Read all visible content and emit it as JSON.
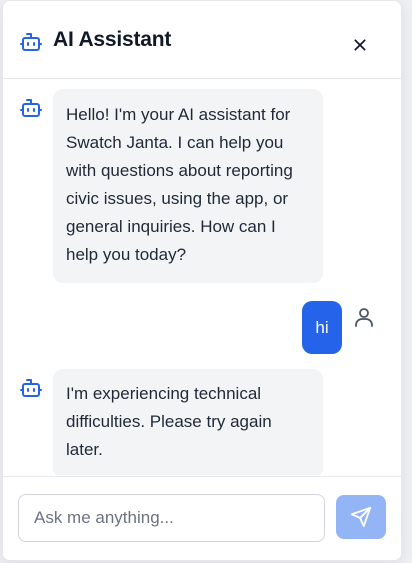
{
  "header": {
    "title": "AI Assistant",
    "icon": "bot-icon",
    "close_icon": "close-icon"
  },
  "messages": [
    {
      "role": "assistant",
      "icon": "bot-icon",
      "text": "Hello! I'm your AI assistant for Swatch Janta. I can help you with questions about reporting civic issues, using the app, or general inquiries. How can I help you today?"
    },
    {
      "role": "user",
      "icon": "user-icon",
      "text": "hi"
    },
    {
      "role": "assistant",
      "icon": "bot-icon",
      "text": "I'm experiencing technical difficulties. Please try again later."
    }
  ],
  "composer": {
    "placeholder": "Ask me anything...",
    "value": "",
    "send_icon": "send-icon"
  },
  "colors": {
    "accent": "#2563eb",
    "send_button_disabled": "#93b4f5",
    "bubble_bg": "#f3f4f6",
    "text": "#1f2937"
  }
}
